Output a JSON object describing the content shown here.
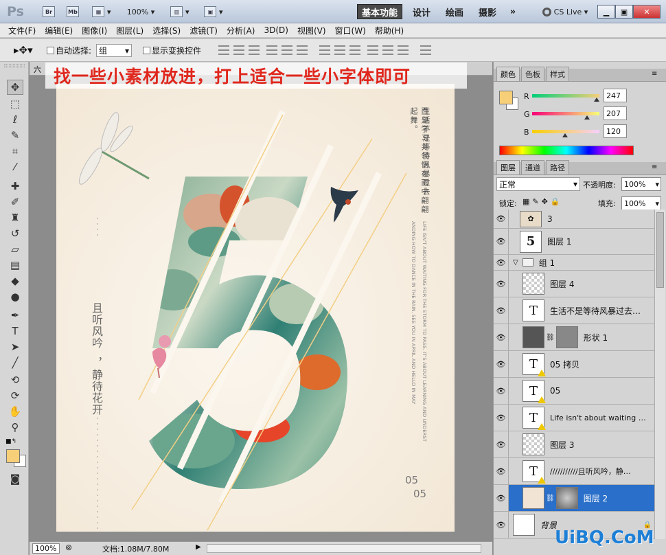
{
  "app": {
    "logo": "Ps",
    "bridge_label": "Br",
    "minibridge_label": "Mb",
    "zoom": "100%",
    "workspaces": [
      "基本功能",
      "设计",
      "绘画",
      "摄影"
    ],
    "more": "»",
    "cs_live": "CS Live"
  },
  "menu": [
    "文件(F)",
    "编辑(E)",
    "图像(I)",
    "图层(L)",
    "选择(S)",
    "滤镜(T)",
    "分析(A)",
    "3D(D)",
    "视图(V)",
    "窗口(W)",
    "帮助(H)"
  ],
  "options": {
    "auto_select_label": "自动选择:",
    "auto_select_value": "组",
    "show_transform_label": "显示变换控件"
  },
  "document": {
    "tab_label": "六",
    "annotation": "找一些小素材放进，打上适合一些小字体即可"
  },
  "poster": {
    "vertical_cn_1": "生活不是等待风暴过去",
    "vertical_cn_2": "而是学习并领悟在雨中翩翩起舞。",
    "vertical_en_1": "LIFE ISN'T ABOUT WAITING FOR THE STORM TO PASS. IT'S ABOUT LEARNING AND UNDERST",
    "vertical_en_2": "ANDING HOW TO DANCE IN THE RAIN. SEE YOU IN APRIL AND HELLO IN MAY",
    "left_cn_1": "且听风吟",
    "left_cn_2": "，静待花开",
    "num_top": "05",
    "num_bottom": "05",
    "big_digit": "5"
  },
  "status": {
    "zoom": "100%",
    "doc_info": "文档:1.08M/7.80M"
  },
  "colors_panel": {
    "tabs": [
      "颜色",
      "色板",
      "样式"
    ],
    "r_label": "R",
    "g_label": "G",
    "b_label": "B",
    "r": "247",
    "g": "207",
    "b": "120",
    "fg_color": "#f7cf78"
  },
  "layers_panel": {
    "tabs": [
      "图层",
      "通道",
      "路径"
    ],
    "blend_mode": "正常",
    "opacity_label": "不透明度:",
    "opacity": "100%",
    "lock_label": "锁定:",
    "fill_label": "填充:",
    "fill": "100%",
    "layers": [
      {
        "name": "3",
        "thumb": "img"
      },
      {
        "name": "图层 1",
        "thumb": "five"
      },
      {
        "name": "组 1",
        "thumb": "folder"
      },
      {
        "name": "图层 4",
        "thumb": "checker"
      },
      {
        "name": "生活不是等待风暴过去…",
        "thumb": "T"
      },
      {
        "name": "形状 1",
        "thumb": "shape"
      },
      {
        "name": "05 拷贝",
        "thumb": "Tw"
      },
      {
        "name": "05",
        "thumb": "Tw"
      },
      {
        "name": "Life isn't about waiting fo…",
        "thumb": "Tw"
      },
      {
        "name": "图层 3",
        "thumb": "checker"
      },
      {
        "name": "///////////且听风吟，静…",
        "thumb": "Tw"
      },
      {
        "name": "图层 2",
        "thumb": "mask"
      },
      {
        "name": "背景",
        "thumb": "white"
      }
    ]
  },
  "watermark": "UiBQ.CoM"
}
